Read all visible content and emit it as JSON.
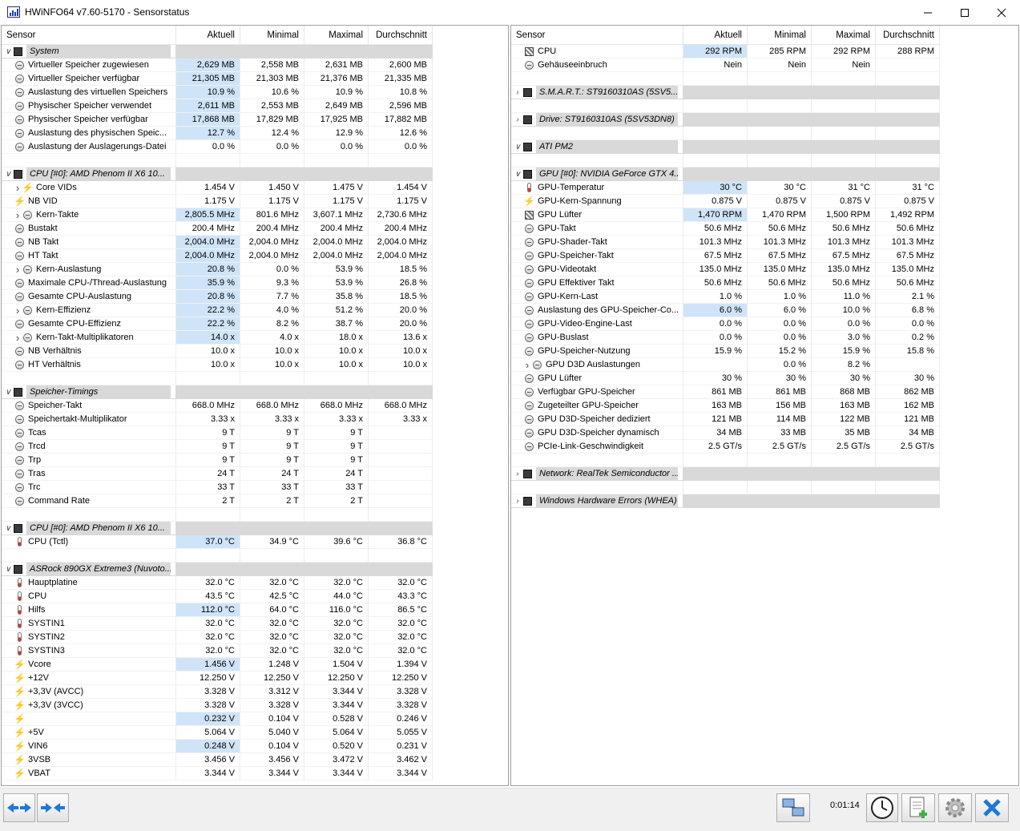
{
  "window": {
    "title": "HWiNFO64 v7.60-5170 - Sensorstatus",
    "controls": [
      "minimize-button",
      "maximize-button",
      "close-button"
    ]
  },
  "columns": [
    "Sensor",
    "Aktuell",
    "Minimal",
    "Maximal",
    "Durchschnitt"
  ],
  "left_panel": {
    "rows": [
      {
        "t": "g",
        "label": "System",
        "arrow": "v",
        "icon": "chip-icon"
      },
      {
        "t": "s",
        "label": "Virtueller Speicher zugewiesen",
        "icon": "gauge-icon",
        "v": [
          "2,629 MB",
          "2,558 MB",
          "2,631 MB",
          "2,600 MB"
        ],
        "hl": true
      },
      {
        "t": "s",
        "label": "Virtueller Speicher verfügbar",
        "icon": "gauge-icon",
        "v": [
          "21,305 MB",
          "21,303 MB",
          "21,376 MB",
          "21,335 MB"
        ],
        "hl": true
      },
      {
        "t": "s",
        "label": "Auslastung des virtuellen Speichers",
        "icon": "gauge-icon",
        "v": [
          "10.9 %",
          "10.6 %",
          "10.9 %",
          "10.8 %"
        ],
        "hl": true
      },
      {
        "t": "s",
        "label": "Physischer Speicher verwendet",
        "icon": "gauge-icon",
        "v": [
          "2,611 MB",
          "2,553 MB",
          "2,649 MB",
          "2,596 MB"
        ],
        "hl": true
      },
      {
        "t": "s",
        "label": "Physischer Speicher verfügbar",
        "icon": "gauge-icon",
        "v": [
          "17,868 MB",
          "17,829 MB",
          "17,925 MB",
          "17,882 MB"
        ],
        "hl": true
      },
      {
        "t": "s",
        "label": "Auslastung des physischen Speic...",
        "icon": "gauge-icon",
        "v": [
          "12.7 %",
          "12.4 %",
          "12.9 %",
          "12.6 %"
        ],
        "hl": true
      },
      {
        "t": "s",
        "label": "Auslastung der Auslagerungs-Datei",
        "icon": "gauge-icon",
        "v": [
          "0.0 %",
          "0.0 %",
          "0.0 %",
          "0.0 %"
        ]
      },
      {
        "t": "b"
      },
      {
        "t": "g",
        "label": "CPU [#0]: AMD Phenom II X6 10...",
        "arrow": "v",
        "icon": "chip-icon"
      },
      {
        "t": "s",
        "label": "Core VIDs",
        "icon": "bolt-icon",
        "arrow": ">",
        "indent": true,
        "v": [
          "1.454 V",
          "1.450 V",
          "1.475 V",
          "1.454 V"
        ]
      },
      {
        "t": "s",
        "label": "NB VID",
        "icon": "bolt-icon",
        "v": [
          "1.175 V",
          "1.175 V",
          "1.175 V",
          "1.175 V"
        ]
      },
      {
        "t": "s",
        "label": "Kern-Takte",
        "icon": "gauge-icon",
        "arrow": ">",
        "indent": true,
        "v": [
          "2,805.5 MHz",
          "801.6 MHz",
          "3,607.1 MHz",
          "2,730.6 MHz"
        ],
        "hl": true
      },
      {
        "t": "s",
        "label": "Bustakt",
        "icon": "gauge-icon",
        "v": [
          "200.4 MHz",
          "200.4 MHz",
          "200.4 MHz",
          "200.4 MHz"
        ]
      },
      {
        "t": "s",
        "label": "NB Takt",
        "icon": "gauge-icon",
        "v": [
          "2,004.0 MHz",
          "2,004.0 MHz",
          "2,004.0 MHz",
          "2,004.0 MHz"
        ],
        "hl": true
      },
      {
        "t": "s",
        "label": "HT Takt",
        "icon": "gauge-icon",
        "v": [
          "2,004.0 MHz",
          "2,004.0 MHz",
          "2,004.0 MHz",
          "2,004.0 MHz"
        ],
        "hl": true
      },
      {
        "t": "s",
        "label": "Kern-Auslastung",
        "icon": "gauge-icon",
        "arrow": ">",
        "indent": true,
        "v": [
          "20.8 %",
          "0.0 %",
          "53.9 %",
          "18.5 %"
        ],
        "hl": true
      },
      {
        "t": "s",
        "label": "Maximale CPU-/Thread-Auslastung",
        "icon": "gauge-icon",
        "v": [
          "35.9 %",
          "9.3 %",
          "53.9 %",
          "26.8 %"
        ],
        "hl": true
      },
      {
        "t": "s",
        "label": "Gesamte CPU-Auslastung",
        "icon": "gauge-icon",
        "v": [
          "20.8 %",
          "7.7 %",
          "35.8 %",
          "18.5 %"
        ],
        "hl": true
      },
      {
        "t": "s",
        "label": "Kern-Effizienz",
        "icon": "gauge-icon",
        "arrow": ">",
        "indent": true,
        "v": [
          "22.2 %",
          "4.0 %",
          "51.2 %",
          "20.0 %"
        ],
        "hl": true
      },
      {
        "t": "s",
        "label": "Gesamte CPU-Effizienz",
        "icon": "gauge-icon",
        "v": [
          "22.2 %",
          "8.2 %",
          "38.7 %",
          "20.0 %"
        ],
        "hl": true
      },
      {
        "t": "s",
        "label": "Kern-Takt-Multiplikatoren",
        "icon": "gauge-icon",
        "arrow": ">",
        "indent": true,
        "v": [
          "14.0 x",
          "4.0 x",
          "18.0 x",
          "13.6 x"
        ],
        "hl": true
      },
      {
        "t": "s",
        "label": "NB Verhältnis",
        "icon": "gauge-icon",
        "v": [
          "10.0 x",
          "10.0 x",
          "10.0 x",
          "10.0 x"
        ]
      },
      {
        "t": "s",
        "label": "HT Verhältnis",
        "icon": "gauge-icon",
        "v": [
          "10.0 x",
          "10.0 x",
          "10.0 x",
          "10.0 x"
        ]
      },
      {
        "t": "b"
      },
      {
        "t": "g",
        "label": "Speicher-Timings",
        "arrow": "v",
        "icon": "chip-icon"
      },
      {
        "t": "s",
        "label": "Speicher-Takt",
        "icon": "gauge-icon",
        "v": [
          "668.0 MHz",
          "668.0 MHz",
          "668.0 MHz",
          "668.0 MHz"
        ]
      },
      {
        "t": "s",
        "label": "Speichertakt-Multiplikator",
        "icon": "gauge-icon",
        "v": [
          "3.33 x",
          "3.33 x",
          "3.33 x",
          "3.33 x"
        ]
      },
      {
        "t": "s",
        "label": "Tcas",
        "icon": "gauge-icon",
        "v": [
          "9 T",
          "9 T",
          "9 T",
          ""
        ]
      },
      {
        "t": "s",
        "label": "Trcd",
        "icon": "gauge-icon",
        "v": [
          "9 T",
          "9 T",
          "9 T",
          ""
        ]
      },
      {
        "t": "s",
        "label": "Trp",
        "icon": "gauge-icon",
        "v": [
          "9 T",
          "9 T",
          "9 T",
          ""
        ]
      },
      {
        "t": "s",
        "label": "Tras",
        "icon": "gauge-icon",
        "v": [
          "24 T",
          "24 T",
          "24 T",
          ""
        ]
      },
      {
        "t": "s",
        "label": "Trc",
        "icon": "gauge-icon",
        "v": [
          "33 T",
          "33 T",
          "33 T",
          ""
        ]
      },
      {
        "t": "s",
        "label": "Command Rate",
        "icon": "gauge-icon",
        "v": [
          "2 T",
          "2 T",
          "2 T",
          ""
        ]
      },
      {
        "t": "b"
      },
      {
        "t": "g",
        "label": "CPU [#0]: AMD Phenom II X6 10...",
        "arrow": "v",
        "icon": "chip-icon"
      },
      {
        "t": "s",
        "label": "CPU (Tctl)",
        "icon": "thermometer-icon",
        "v": [
          "37.0 °C",
          "34.9 °C",
          "39.6 °C",
          "36.8 °C"
        ],
        "hl": true
      },
      {
        "t": "b"
      },
      {
        "t": "g",
        "label": "ASRock 890GX Extreme3 (Nuvoto...",
        "arrow": "v",
        "icon": "chip-icon"
      },
      {
        "t": "s",
        "label": "Hauptplatine",
        "icon": "thermometer-icon",
        "v": [
          "32.0 °C",
          "32.0 °C",
          "32.0 °C",
          "32.0 °C"
        ]
      },
      {
        "t": "s",
        "label": "CPU",
        "icon": "thermometer-icon",
        "v": [
          "43.5 °C",
          "42.5 °C",
          "44.0 °C",
          "43.3 °C"
        ]
      },
      {
        "t": "s",
        "label": "Hilfs",
        "icon": "thermometer-icon",
        "v": [
          "112.0 °C",
          "64.0 °C",
          "116.0 °C",
          "86.5 °C"
        ],
        "hl": true
      },
      {
        "t": "s",
        "label": "SYSTIN1",
        "icon": "thermometer-icon",
        "v": [
          "32.0 °C",
          "32.0 °C",
          "32.0 °C",
          "32.0 °C"
        ]
      },
      {
        "t": "s",
        "label": "SYSTIN2",
        "icon": "thermometer-icon",
        "v": [
          "32.0 °C",
          "32.0 °C",
          "32.0 °C",
          "32.0 °C"
        ]
      },
      {
        "t": "s",
        "label": "SYSTIN3",
        "icon": "thermometer-icon",
        "v": [
          "32.0 °C",
          "32.0 °C",
          "32.0 °C",
          "32.0 °C"
        ]
      },
      {
        "t": "s",
        "label": "Vcore",
        "icon": "bolt-icon",
        "v": [
          "1.456 V",
          "1.248 V",
          "1.504 V",
          "1.394 V"
        ],
        "hl": true
      },
      {
        "t": "s",
        "label": "+12V",
        "icon": "bolt-icon",
        "v": [
          "12.250 V",
          "12.250 V",
          "12.250 V",
          "12.250 V"
        ]
      },
      {
        "t": "s",
        "label": "+3,3V (AVCC)",
        "icon": "bolt-icon",
        "v": [
          "3.328 V",
          "3.312 V",
          "3.344 V",
          "3.328 V"
        ]
      },
      {
        "t": "s",
        "label": "+3,3V (3VCC)",
        "icon": "bolt-icon",
        "v": [
          "3.328 V",
          "3.328 V",
          "3.344 V",
          "3.328 V"
        ]
      },
      {
        "t": "s",
        "label": "",
        "icon": "bolt-icon",
        "v": [
          "0.232 V",
          "0.104 V",
          "0.528 V",
          "0.246 V"
        ],
        "hl": true
      },
      {
        "t": "s",
        "label": "+5V",
        "icon": "bolt-icon",
        "v": [
          "5.064 V",
          "5.040 V",
          "5.064 V",
          "5.055 V"
        ]
      },
      {
        "t": "s",
        "label": "VIN6",
        "icon": "bolt-icon",
        "v": [
          "0.248 V",
          "0.104 V",
          "0.520 V",
          "0.231 V"
        ],
        "hl": true
      },
      {
        "t": "s",
        "label": "3VSB",
        "icon": "bolt-icon",
        "v": [
          "3.456 V",
          "3.456 V",
          "3.472 V",
          "3.462 V"
        ]
      },
      {
        "t": "s",
        "label": "VBAT",
        "icon": "bolt-icon",
        "v": [
          "3.344 V",
          "3.344 V",
          "3.344 V",
          "3.344 V"
        ]
      }
    ]
  },
  "right_panel": {
    "rows": [
      {
        "t": "s",
        "label": "CPU",
        "icon": "fan-icon",
        "v": [
          "292 RPM",
          "285 RPM",
          "292 RPM",
          "288 RPM"
        ],
        "hl": true
      },
      {
        "t": "s",
        "label": "Gehäuseeinbruch",
        "icon": "gauge-icon",
        "v": [
          "Nein",
          "Nein",
          "Nein",
          ""
        ]
      },
      {
        "t": "b"
      },
      {
        "t": "g",
        "label": "S.M.A.R.T.: ST9160310AS (5SV5...",
        "arrow": ">",
        "icon": "chip-icon"
      },
      {
        "t": "b"
      },
      {
        "t": "g",
        "label": "Drive: ST9160310AS (5SV53DN8)",
        "arrow": ">",
        "icon": "chip-icon"
      },
      {
        "t": "b"
      },
      {
        "t": "g",
        "label": "ATI PM2",
        "arrow": "v",
        "icon": "chip-icon"
      },
      {
        "t": "b"
      },
      {
        "t": "g",
        "label": "GPU [#0]: NVIDIA GeForce GTX 4...",
        "arrow": "v",
        "icon": "chip-icon"
      },
      {
        "t": "s",
        "label": "GPU-Temperatur",
        "icon": "thermometer-icon",
        "v": [
          "30 °C",
          "30 °C",
          "31 °C",
          "31 °C"
        ],
        "hl": true
      },
      {
        "t": "s",
        "label": "GPU-Kern-Spannung",
        "icon": "bolt-icon",
        "v": [
          "0.875 V",
          "0.875 V",
          "0.875 V",
          "0.875 V"
        ]
      },
      {
        "t": "s",
        "label": "GPU Lüfter",
        "icon": "fan-icon",
        "v": [
          "1,470 RPM",
          "1,470 RPM",
          "1,500 RPM",
          "1,492 RPM"
        ],
        "hl": true
      },
      {
        "t": "s",
        "label": "GPU-Takt",
        "icon": "gauge-icon",
        "v": [
          "50.6 MHz",
          "50.6 MHz",
          "50.6 MHz",
          "50.6 MHz"
        ]
      },
      {
        "t": "s",
        "label": "GPU-Shader-Takt",
        "icon": "gauge-icon",
        "v": [
          "101.3 MHz",
          "101.3 MHz",
          "101.3 MHz",
          "101.3 MHz"
        ]
      },
      {
        "t": "s",
        "label": "GPU-Speicher-Takt",
        "icon": "gauge-icon",
        "v": [
          "67.5 MHz",
          "67.5 MHz",
          "67.5 MHz",
          "67.5 MHz"
        ]
      },
      {
        "t": "s",
        "label": "GPU-Videotakt",
        "icon": "gauge-icon",
        "v": [
          "135.0 MHz",
          "135.0 MHz",
          "135.0 MHz",
          "135.0 MHz"
        ]
      },
      {
        "t": "s",
        "label": "GPU Effektiver Takt",
        "icon": "gauge-icon",
        "v": [
          "50.6 MHz",
          "50.6 MHz",
          "50.6 MHz",
          "50.6 MHz"
        ]
      },
      {
        "t": "s",
        "label": "GPU-Kern-Last",
        "icon": "gauge-icon",
        "v": [
          "1.0 %",
          "1.0 %",
          "11.0 %",
          "2.1 %"
        ]
      },
      {
        "t": "s",
        "label": "Auslastung des GPU-Speicher-Co...",
        "icon": "gauge-icon",
        "v": [
          "6.0 %",
          "6.0 %",
          "10.0 %",
          "6.8 %"
        ],
        "hl": true
      },
      {
        "t": "s",
        "label": "GPU-Video-Engine-Last",
        "icon": "gauge-icon",
        "v": [
          "0.0 %",
          "0.0 %",
          "0.0 %",
          "0.0 %"
        ]
      },
      {
        "t": "s",
        "label": "GPU-Buslast",
        "icon": "gauge-icon",
        "v": [
          "0.0 %",
          "0.0 %",
          "3.0 %",
          "0.2 %"
        ]
      },
      {
        "t": "s",
        "label": "GPU-Speicher-Nutzung",
        "icon": "gauge-icon",
        "v": [
          "15.9 %",
          "15.2 %",
          "15.9 %",
          "15.8 %"
        ]
      },
      {
        "t": "s",
        "label": "GPU D3D Auslastungen",
        "icon": "gauge-icon",
        "arrow": ">",
        "indent": true,
        "v": [
          "",
          "0.0 %",
          "8.2 %",
          ""
        ]
      },
      {
        "t": "s",
        "label": "GPU Lüfter",
        "icon": "gauge-icon",
        "v": [
          "30 %",
          "30 %",
          "30 %",
          "30 %"
        ]
      },
      {
        "t": "s",
        "label": "Verfügbar GPU-Speicher",
        "icon": "gauge-icon",
        "v": [
          "861 MB",
          "861 MB",
          "868 MB",
          "862 MB"
        ]
      },
      {
        "t": "s",
        "label": "Zugeteilter GPU-Speicher",
        "icon": "gauge-icon",
        "v": [
          "163 MB",
          "156 MB",
          "163 MB",
          "162 MB"
        ]
      },
      {
        "t": "s",
        "label": "GPU D3D-Speicher dediziert",
        "icon": "gauge-icon",
        "v": [
          "121 MB",
          "114 MB",
          "122 MB",
          "121 MB"
        ]
      },
      {
        "t": "s",
        "label": "GPU D3D-Speicher dynamisch",
        "icon": "gauge-icon",
        "v": [
          "34 MB",
          "33 MB",
          "35 MB",
          "34 MB"
        ]
      },
      {
        "t": "s",
        "label": "PCIe-Link-Geschwindigkeit",
        "icon": "gauge-icon",
        "v": [
          "2.5 GT/s",
          "2.5 GT/s",
          "2.5 GT/s",
          "2.5 GT/s"
        ]
      },
      {
        "t": "b"
      },
      {
        "t": "g",
        "label": "Network: RealTek Semiconductor ...",
        "arrow": ">",
        "icon": "chip-icon"
      },
      {
        "t": "b"
      },
      {
        "t": "g",
        "label": "Windows Hardware Errors (WHEA)",
        "arrow": ">",
        "icon": "chip-icon"
      }
    ]
  },
  "statusbar": {
    "timer": "0:01:14",
    "buttons": [
      "nav-back-button",
      "nav-forward-button",
      "network-button",
      "clock-button",
      "add-report-button",
      "settings-button",
      "close-sensors-button"
    ]
  },
  "colors": {
    "highlight": "#cfe4f8",
    "group_bg": "#d9d9d9",
    "accent_blue": "#1e78d7"
  }
}
